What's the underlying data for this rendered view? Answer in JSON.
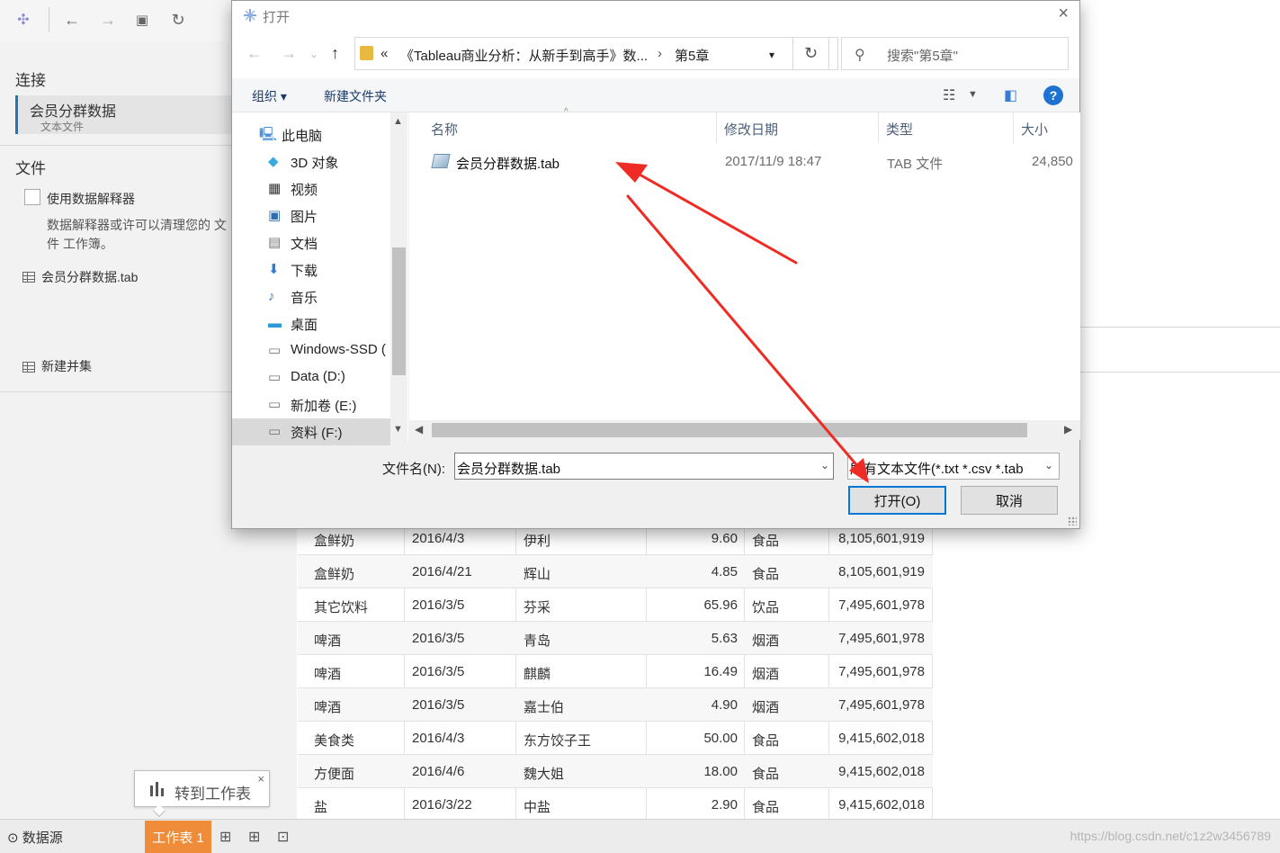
{
  "toolbar": {
    "icons": [
      "tableau-logo-icon",
      "back-icon",
      "forward-icon",
      "save-icon",
      "refresh-icon"
    ]
  },
  "sidebar": {
    "connections_heading": "连接",
    "connection": {
      "name": "会员分群数据",
      "type": "文本文件"
    },
    "files_heading": "文件",
    "interpreter_label": "使用数据解释器",
    "interpreter_desc_1": "数据解释器或许可以清理您的 文",
    "interpreter_desc_2": "件 工作簿。",
    "file_item": "会员分群数据.tab",
    "new_union": "新建并集"
  },
  "tooltip": {
    "text": "转到工作表",
    "close": "×"
  },
  "data_rows": [
    [
      "盒鲜奶",
      "2016/4/3",
      "伊利",
      "9.60",
      "食品",
      "8,105,601,919"
    ],
    [
      "盒鲜奶",
      "2016/4/21",
      "辉山",
      "4.85",
      "食品",
      "8,105,601,919"
    ],
    [
      "其它饮料",
      "2016/3/5",
      "芬采",
      "65.96",
      "饮品",
      "7,495,601,978"
    ],
    [
      "啤酒",
      "2016/3/5",
      "青岛",
      "5.63",
      "烟酒",
      "7,495,601,978"
    ],
    [
      "啤酒",
      "2016/3/5",
      "麒麟",
      "16.49",
      "烟酒",
      "7,495,601,978"
    ],
    [
      "啤酒",
      "2016/3/5",
      "嘉士伯",
      "4.90",
      "烟酒",
      "7,495,601,978"
    ],
    [
      "美食类",
      "2016/4/3",
      "东方饺子王",
      "50.00",
      "食品",
      "9,415,602,018"
    ],
    [
      "方便面",
      "2016/4/6",
      "魏大姐",
      "18.00",
      "食品",
      "9,415,602,018"
    ],
    [
      "盐",
      "2016/3/22",
      "中盐",
      "2.90",
      "食品",
      "9,415,602,018"
    ]
  ],
  "bottombar": {
    "datasource_tab": "数据源",
    "worksheet_tab": "工作表 1",
    "watermark": "https://blog.csdn.net/c1z2w3456789"
  },
  "dialog": {
    "title": "打开",
    "close": "×",
    "address": {
      "chevron": "«",
      "segment_1": "《Tableau商业分析：从新手到高手》数...",
      "separator": "›",
      "segment_2": "第5章"
    },
    "search_placeholder": "搜索\"第5章\"",
    "commands": {
      "organize": "组织 ▾",
      "new_folder": "新建文件夹",
      "help": "?"
    },
    "nav_items": [
      {
        "label": "此电脑",
        "icon": "computer-icon"
      },
      {
        "label": "3D 对象",
        "icon": "cube-icon"
      },
      {
        "label": "视频",
        "icon": "video-icon"
      },
      {
        "label": "图片",
        "icon": "picture-icon"
      },
      {
        "label": "文档",
        "icon": "document-icon"
      },
      {
        "label": "下载",
        "icon": "download-icon"
      },
      {
        "label": "音乐",
        "icon": "music-icon"
      },
      {
        "label": "桌面",
        "icon": "desktop-icon"
      },
      {
        "label": "Windows-SSD (",
        "icon": "drive-icon"
      },
      {
        "label": "Data (D:)",
        "icon": "drive-icon"
      },
      {
        "label": "新加卷 (E:)",
        "icon": "drive-icon"
      },
      {
        "label": "资料 (F:)",
        "icon": "drive-icon"
      }
    ],
    "columns": {
      "name": "名称",
      "date": "修改日期",
      "type": "类型",
      "size": "大小"
    },
    "file": {
      "name": "会员分群数据.tab",
      "date": "2017/11/9 18:47",
      "type": "TAB 文件",
      "size": "24,850"
    },
    "filename_label": "文件名(N):",
    "filename_value": "会员分群数据.tab",
    "filetype_value": "所有文本文件(*.txt *.csv *.tab",
    "open_button": "打开(O)",
    "cancel_button": "取消"
  },
  "colors": {
    "accent": "#1f77b4",
    "worksheet_tab": "#ef8c3a",
    "arrow": "#ee2b24",
    "help": "#1e73d2"
  }
}
